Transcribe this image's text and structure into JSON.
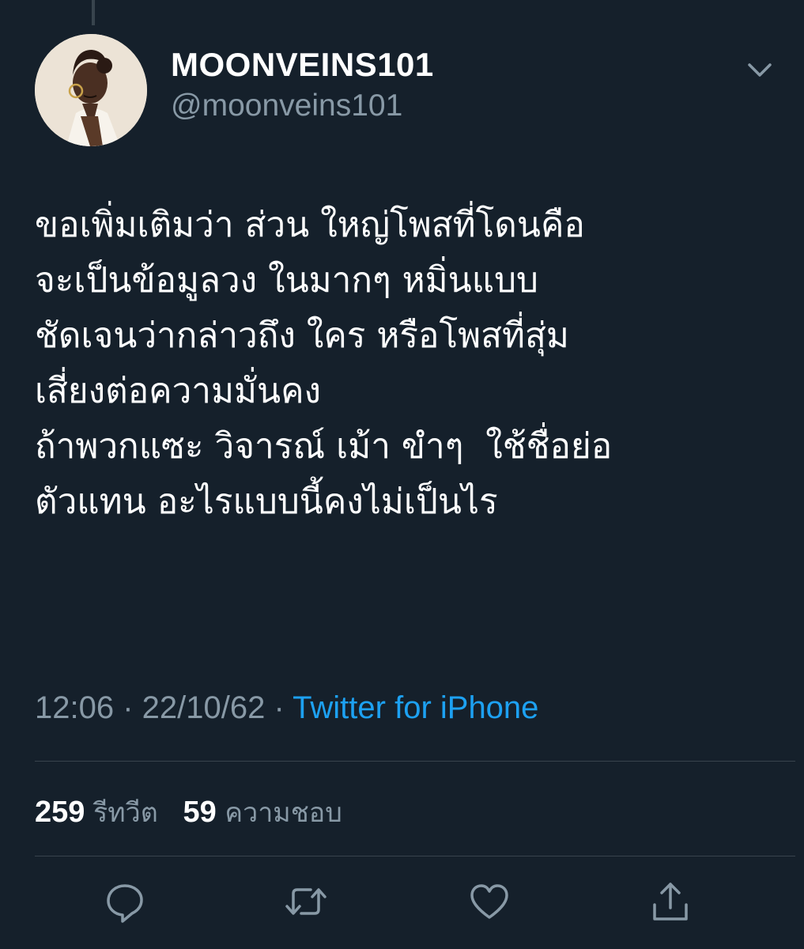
{
  "author": {
    "display_name": "MOONVEINS101",
    "handle": "@moonveins101",
    "avatar_icon": "profile-avatar"
  },
  "tweet": {
    "text": "ขอเพิ่มเติมว่า ส่วน ใหญ่โพสที่โดนคือ\nจะเป็นข้อมูลวง ในมากๆ หมิ่นแบบ\nชัดเจนว่ากล่าวถึง ใคร หรือโพสที่สุ่ม\nเสี่ยงต่อความมั่นคง\nถ้าพวกแซะ วิจารณ์ เม้า ขำๆ  ใช้ชื่อย่อ\nตัวแทน อะไรแบบนี้คงไม่เป็นไร",
    "time": "12:06 · 22/10/62 · ",
    "source": "Twitter for iPhone"
  },
  "stats": {
    "retweets_count": "259",
    "retweets_label": "รีทวีต",
    "likes_count": "59",
    "likes_label": "ความชอบ"
  },
  "icons": {
    "menu": "chevron-down-icon",
    "reply": "reply-icon",
    "retweet": "retweet-icon",
    "like": "heart-icon",
    "share": "share-icon"
  },
  "colors": {
    "background": "#15202b",
    "primary_text": "#ffffff",
    "secondary_text": "#8899a6",
    "link": "#1da1f2",
    "divider": "#38444d"
  }
}
